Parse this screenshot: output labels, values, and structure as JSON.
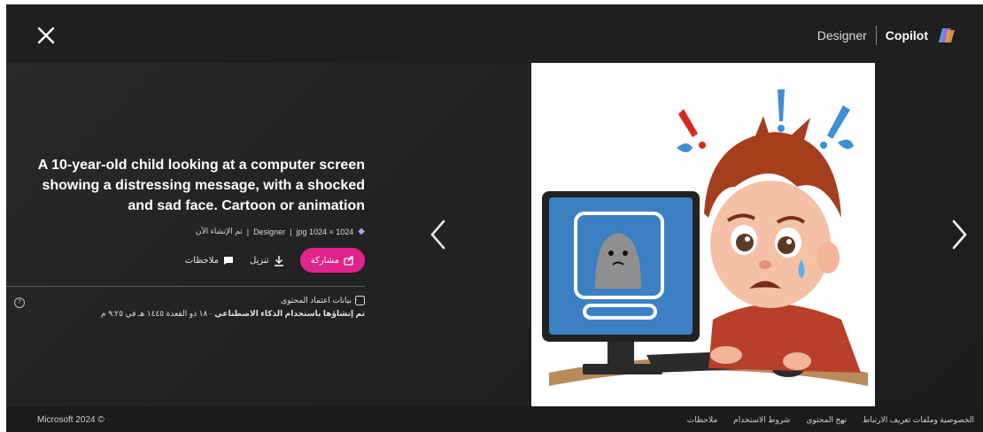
{
  "header": {
    "brand_designer": "Designer",
    "brand_copilot": "Copilot"
  },
  "image": {
    "title": "A 10-year-old child looking at a computer screen showing a distressing message, with a shocked and sad face. Cartoon or animation",
    "meta": {
      "size": "1024 × 1024 jpg",
      "app": "Designer",
      "created": "تم الإنشاء الآن"
    }
  },
  "actions": {
    "share_label": "مشاركة",
    "download_label": "تنزيل",
    "feedback_label": "ملاحظات"
  },
  "credentials": {
    "label": "بيانات اعتماد المحتوى",
    "generated_bold": "تم إنشاؤها باستخدام الذكاء الاصطناعي",
    "generated_date": " · ١٨ ذو القعدة ١٤٤٥ هـ في ٩:٢٥ م"
  },
  "footer": {
    "copyright": "Microsoft 2024 ©",
    "links": [
      "الخصوصية وملفات تعريف الارتباط",
      "نهج المحتوى",
      "شروط الاستخدام",
      "ملاحظات"
    ]
  },
  "colors": {
    "share_accent": "#e0258a",
    "background": "#232224"
  }
}
